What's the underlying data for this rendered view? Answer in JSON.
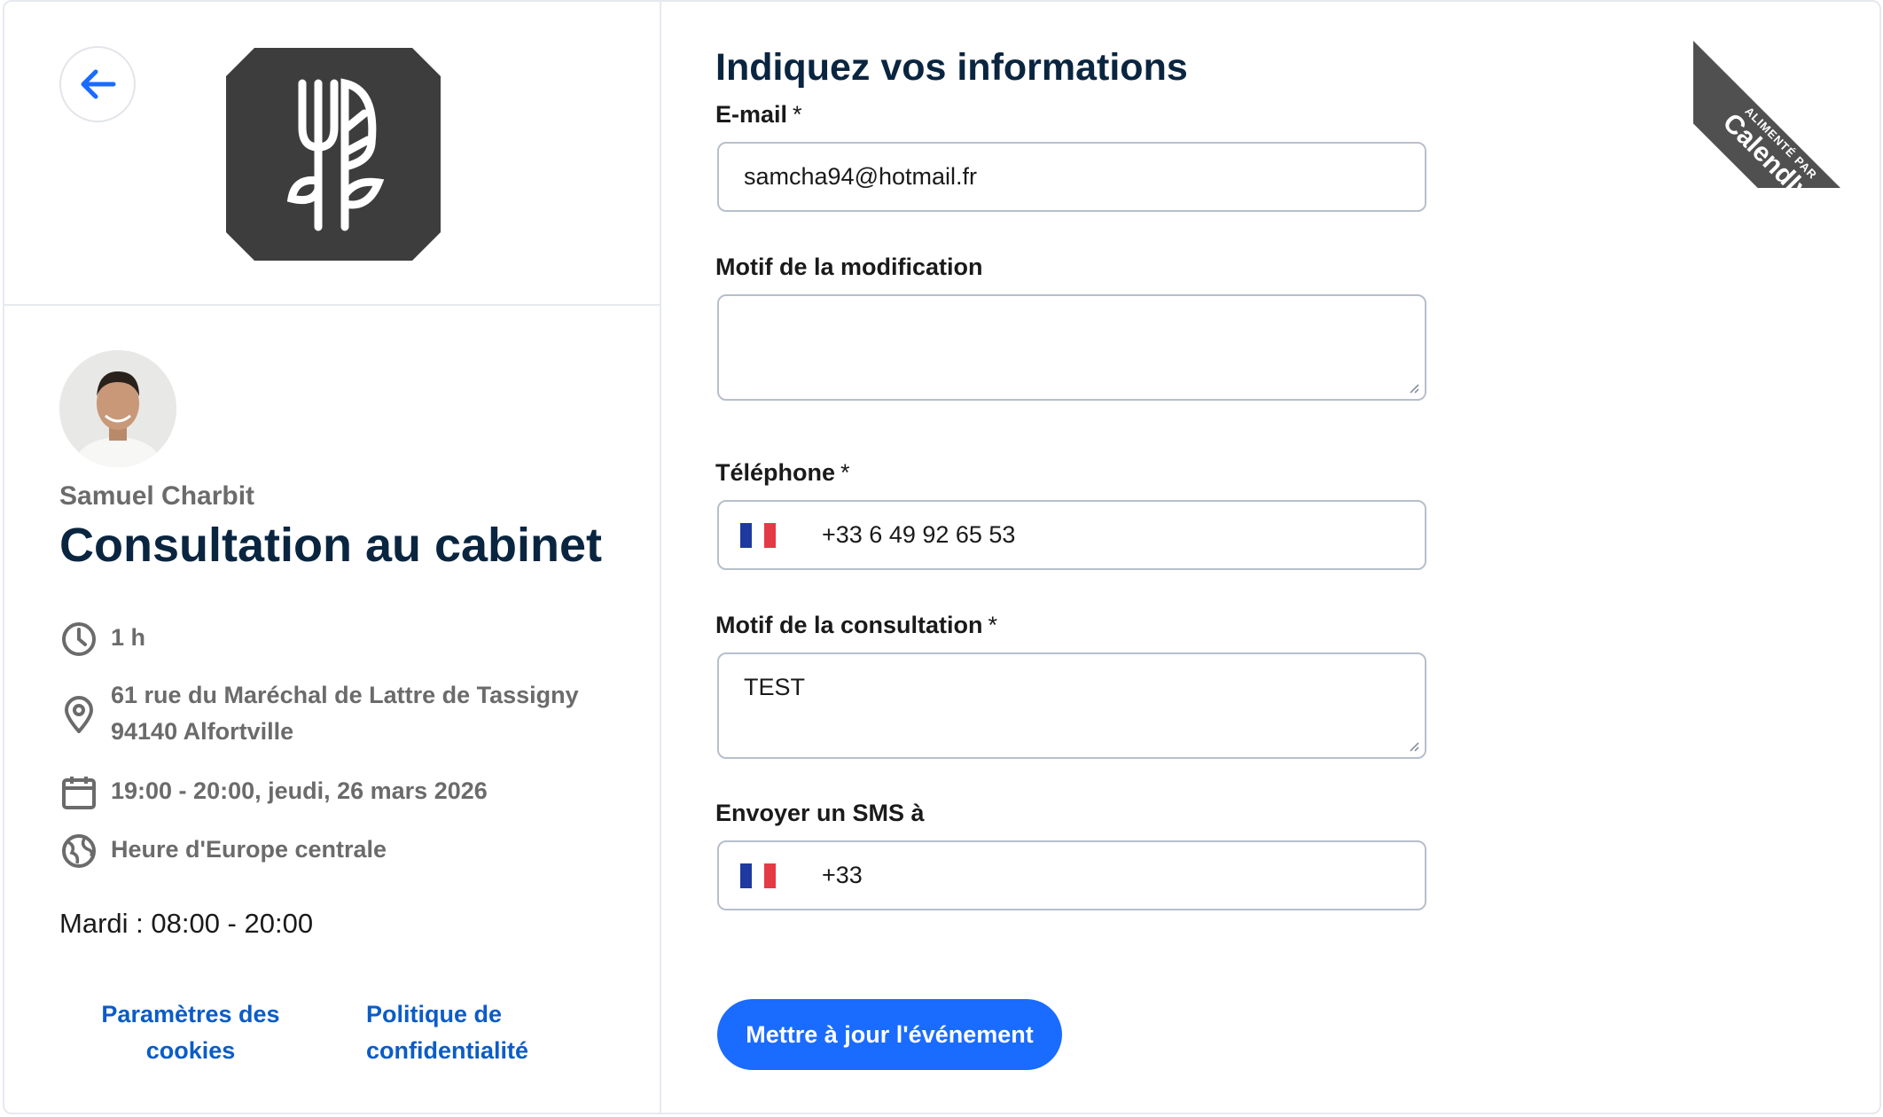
{
  "ribbon": {
    "powered_by": "ALIMENTÉ PAR",
    "brand": "Calendly"
  },
  "sidebar": {
    "host_name": "Samuel Charbit",
    "event_title": "Consultation au cabinet",
    "duration": "1 h",
    "address_line1": "61 rue du Maréchal de Lattre de Tassigny",
    "address_line2": "94140 Alfortville",
    "datetime": "19:00 - 20:00, jeudi, 26 mars 2026",
    "timezone": "Heure d'Europe centrale",
    "hours": "Mardi : 08:00 - 20:00",
    "cookies_line1": "Paramètres des",
    "cookies_line2": "cookies",
    "privacy_line1": "Politique de",
    "privacy_line2": "confidentialité"
  },
  "form": {
    "title": "Indiquez vos informations",
    "email_label": "E-mail",
    "email_value": "samcha94@hotmail.fr",
    "modif_label": "Motif de la modification",
    "modif_value": "",
    "phone_label": "Téléphone",
    "phone_value": "+33 6 49 92 65 53",
    "reason_label": "Motif de la consultation",
    "reason_value": "TEST",
    "sms_label": "Envoyer un SMS à",
    "sms_value": "+33",
    "required_mark": "*",
    "submit_label": "Mettre à jour l'événement"
  },
  "colors": {
    "accent": "#1a6bff",
    "link": "#0b5cc7",
    "heading": "#0a2540",
    "flag_blue": "#1e3aa0",
    "flag_red": "#e63946"
  }
}
